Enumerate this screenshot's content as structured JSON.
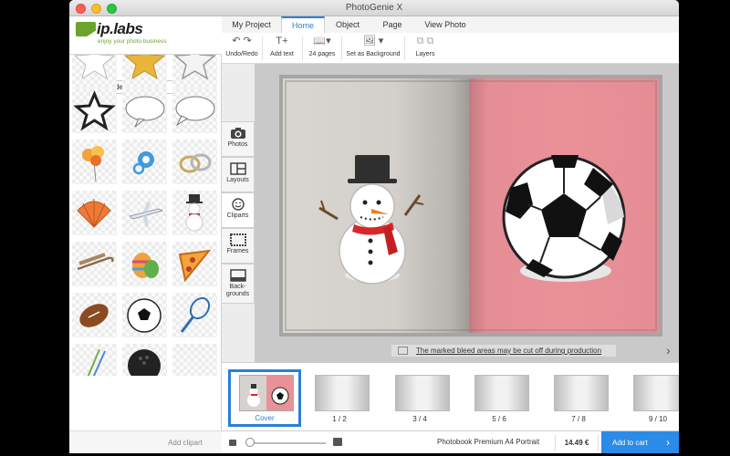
{
  "window": {
    "title": "PhotoGenie X"
  },
  "logo": {
    "brand": "ip.labs",
    "tagline": "enjoy your photo business",
    "brand_color": "#6ca32e"
  },
  "tabs": [
    {
      "label": "My Project",
      "active": false
    },
    {
      "label": "Home",
      "active": true
    },
    {
      "label": "Object",
      "active": false
    },
    {
      "label": "Page",
      "active": false
    },
    {
      "label": "View Photo",
      "active": false
    }
  ],
  "toolbar": {
    "undo_redo": "Undo/Redo",
    "add_text": "Add text",
    "pages": "24 pages",
    "set_background": "Set as Background",
    "layers": "Layers"
  },
  "cliparts": {
    "category": "iplhandmade",
    "items": [
      "star-white",
      "star-gold",
      "star-outline-white",
      "star-black-outline",
      "speech-bubble",
      "speech-bubble-left",
      "balloons",
      "pacifier",
      "wedding-rings",
      "seashell",
      "airplane",
      "snowman",
      "sled",
      "easter-egg",
      "pizza-slice",
      "american-football",
      "soccer-ball",
      "tennis-racket",
      "chopsticks",
      "bowling-ball",
      "blank"
    ],
    "add_label": "Add clipart"
  },
  "sidetabs": [
    {
      "label": "Photos",
      "icon": "camera-icon"
    },
    {
      "label": "Layouts",
      "icon": "layout-icon"
    },
    {
      "label": "Cliparts",
      "icon": "smiley-icon"
    },
    {
      "label": "Frames",
      "icon": "frame-icon"
    },
    {
      "label": "Back-\ngrounds",
      "icon": "background-icon"
    }
  ],
  "canvas": {
    "bleed_notice": "The marked bleed areas may be cut off during production",
    "left_page_color": "#d6d2cd",
    "right_page_color": "#ea9198"
  },
  "pages_strip": [
    {
      "label": "Cover",
      "selected": true
    },
    {
      "label": "1 / 2"
    },
    {
      "label": "3 / 4"
    },
    {
      "label": "5 / 6"
    },
    {
      "label": "7 / 8"
    },
    {
      "label": "9 / 10"
    }
  ],
  "bottom": {
    "product": "Photobook Premium A4 Portrait",
    "price": "14.49 €",
    "cart_label": "Add to cart",
    "accent": "#2b8be8"
  }
}
